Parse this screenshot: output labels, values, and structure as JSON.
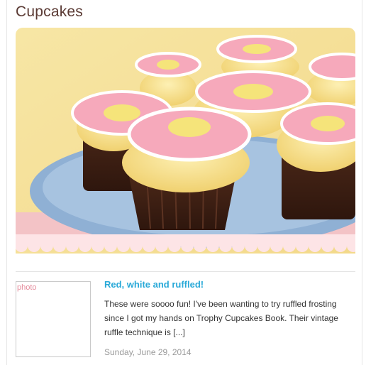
{
  "page": {
    "title": "Cupcakes"
  },
  "featured_image": {
    "alt": "Pink flower-topped cupcakes on a blue scalloped plate"
  },
  "post": {
    "thumbnail_label": "photo",
    "title": "Red, white and ruffled!",
    "excerpt": "These were soooo fun! I've been wanting to try ruffled frosting since I got my hands on Trophy Cupcakes Book. Their vintage ruffle technique is [...]",
    "date": "Sunday, June 29, 2014"
  },
  "colors": {
    "title": "#5a3a34",
    "link": "#29a9d8",
    "photo_label": "#e58c9c",
    "scallop": "#fde4e6"
  }
}
